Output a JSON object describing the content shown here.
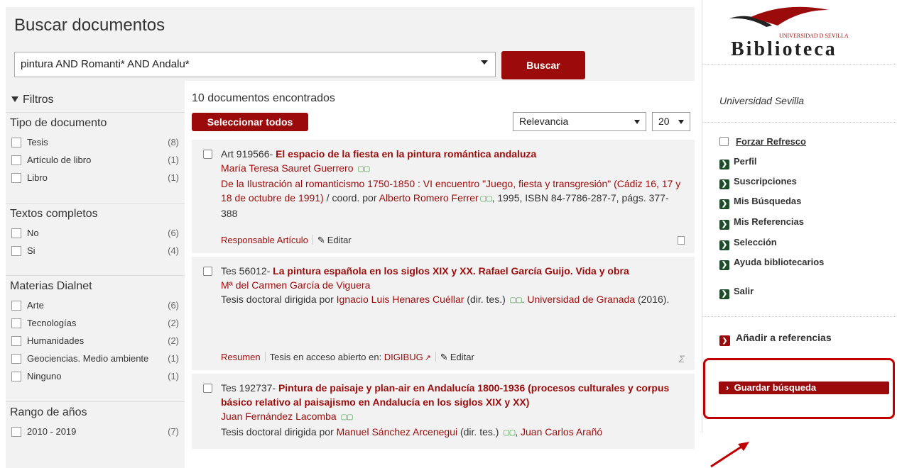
{
  "search": {
    "title": "Buscar documentos",
    "query": "pintura AND Romanti* AND Andalu*",
    "button": "Buscar"
  },
  "filters": {
    "header": "Filtros",
    "groups": [
      {
        "title": "Tipo de documento",
        "items": [
          {
            "label": "Tesis",
            "count": "(8)"
          },
          {
            "label": "Artículo de libro",
            "count": "(1)"
          },
          {
            "label": "Libro",
            "count": "(1)"
          }
        ]
      },
      {
        "title": "Textos completos",
        "items": [
          {
            "label": "No",
            "count": "(6)"
          },
          {
            "label": "Si",
            "count": "(4)"
          }
        ]
      },
      {
        "title": "Materias Dialnet",
        "items": [
          {
            "label": "Arte",
            "count": "(6)"
          },
          {
            "label": "Tecnologías",
            "count": "(2)"
          },
          {
            "label": "Humanidades",
            "count": "(2)"
          },
          {
            "label": "Geociencias. Medio ambiente",
            "count": "(1)"
          },
          {
            "label": "Ninguno",
            "count": "(1)"
          }
        ]
      },
      {
        "title": "Rango de años",
        "items": [
          {
            "label": "2010 - 2019",
            "count": "(7)"
          }
        ]
      }
    ]
  },
  "results": {
    "count_text": "10 documentos encontrados",
    "select_all": "Seleccionar todos",
    "sort": "Relevancia",
    "page_size": "20",
    "items": [
      {
        "prefix": "Art 919566-",
        "title": "El espacio de la fiesta en la pintura romántica andaluza",
        "author": "María Teresa Sauret Guerrero",
        "source_link": "De la Ilustración al romanticismo 1750-1850 : VI encuentro \"Juego, fiesta y transgresión\" (Cádiz 16, 17 y 18 de octubre de 1991)",
        "source_rest1": " / coord. por ",
        "source_editor": "Alberto Romero Ferrer",
        "source_rest2": ", 1995, ISBN 84-7786-287-7, págs. 377-388",
        "action1": "Responsable Artículo",
        "action2": "Editar"
      },
      {
        "prefix": "Tes 56012-",
        "title": "La pintura española en los siglos XIX y XX. Rafael García Guijo. Vida y obra",
        "author": "Mª del Carmen García de Viguera",
        "desc1": "Tesis doctoral dirigida por ",
        "director": "Ignacio Luis Henares Cuéllar",
        "desc2": " (dir. tes.) ",
        "desc3": ". ",
        "university": "Universidad de Granada",
        "desc4": " (2016).",
        "action1": "Resumen",
        "action2_prefix": "Tesis en acceso abierto en: ",
        "action2_link": "DIGIBUG",
        "action3": "Editar"
      },
      {
        "prefix": "Tes 192737-",
        "title": "Pintura de paisaje y plan-air en Andalucía 1800-1936 (procesos culturales y corpus básico relativo al paisajismo en Andalucía en los siglos XIX y XX)",
        "author": "Juan Fernández Lacomba",
        "desc1": "Tesis doctoral dirigida por ",
        "director": "Manuel Sánchez Arcenegui",
        "desc2": " (dir. tes.) ",
        "desc3": ", ",
        "codirector": "Juan Carlos Arañó"
      }
    ]
  },
  "sidebar": {
    "logo_small": "UNIVERSIDAD D SEVILLA",
    "logo_text": "Biblioteca",
    "university": "Universidad Sevilla",
    "force_refresh": "Forzar Refresco",
    "items": [
      "Perfil",
      "Suscripciones",
      "Mis Búsquedas",
      "Mis Referencias",
      "Selección",
      "Ayuda bibliotecarios",
      "Salir"
    ],
    "add_references": "Añadir a referencias",
    "save_search": "Guardar búsqueda"
  },
  "colors": {
    "accent": "#9c0b0b",
    "sidebar_icon": "#1e4d2b",
    "highlight": "#c00000",
    "panel": "#f2f2f2"
  }
}
